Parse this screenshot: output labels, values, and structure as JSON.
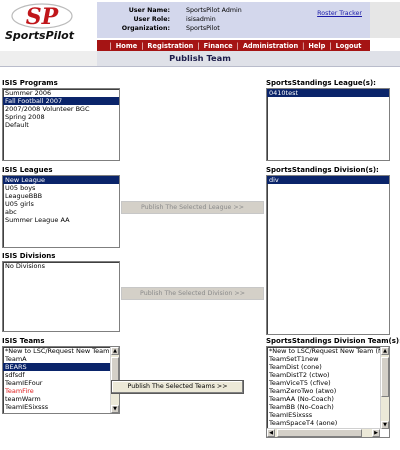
{
  "logo": {
    "text": "SportsPilot",
    "monogram": "SP"
  },
  "user": {
    "name_label": "User Name:",
    "name_value": "SportsPilot Admin",
    "role_label": "User Role:",
    "role_value": "isisadmin",
    "org_label": "Organization:",
    "org_value": "SportsPilot"
  },
  "roster_link": "Roster Tracker",
  "nav": [
    "Home",
    "Registration",
    "Finance",
    "Administration",
    "Help",
    "Logout"
  ],
  "page_title": "Publish Team",
  "isis_programs": {
    "label": "ISIS Programs",
    "items": [
      "Summer 2006",
      "Fall Football 2007",
      "2007/2008 Volunteer BGC",
      "Spring 2008",
      "Default"
    ],
    "selected": 1
  },
  "ss_leagues": {
    "label": "SportsStandings League(s):",
    "items": [
      "0410test"
    ],
    "selected": 0
  },
  "isis_leagues": {
    "label": "ISIS Leagues",
    "items": [
      "New League",
      "U05 boys",
      "LeagueBBB",
      "U05 girls",
      "abc",
      "Summer League AA"
    ],
    "selected": 0
  },
  "ss_divisions": {
    "label": "SportsStandings Division(s):",
    "items": [
      "div"
    ],
    "selected": 0
  },
  "isis_divisions": {
    "label": "ISIS Divisions",
    "items": [
      "No Divisions"
    ]
  },
  "isis_teams": {
    "label": "ISIS Teams",
    "items": [
      "*New to LSC/Request New Team",
      "TeamA",
      "BEARS",
      "sdfsdf",
      "TeamIEFour",
      "TeamFire",
      "teamWarm",
      "TeamIESixsss"
    ],
    "selected": 2,
    "red_item": 5
  },
  "ss_teams": {
    "label": "SportsStandings Division Team(s):",
    "items": [
      "*New to LSC/Request New Team (No-",
      "TeamSetT1new",
      "TeamDist (cone)",
      "TeamDistT2 (ctwo)",
      "TeamViceT5 (cfive)",
      "TeamZeroTwo (atwo)",
      "TeamAA (No-Coach)",
      "TeamBB (No-Coach)",
      "TeamIESixsss",
      "TeamSpaceT4 (aone)"
    ]
  },
  "buttons": {
    "publish_league": "Publish The Selected League >>",
    "publish_division": "Publish The Selected Division >>",
    "publish_teams": "Publish The Selected Teams >>"
  },
  "colors": {
    "nav_bg": "#a51414",
    "selection": "#0a246a",
    "userinfo_bg": "#d3d7ec",
    "red_text": "#e02020"
  }
}
